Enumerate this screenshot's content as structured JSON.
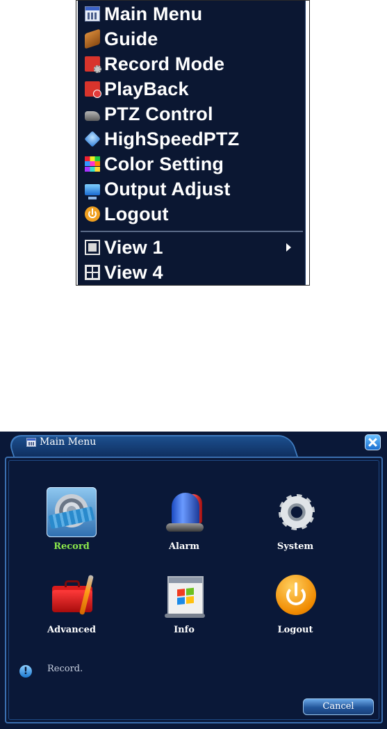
{
  "context_menu": {
    "items": [
      {
        "label": "Main Menu",
        "icon": "main-menu-icon"
      },
      {
        "label": "Guide",
        "icon": "guide-icon"
      },
      {
        "label": "Record Mode",
        "icon": "record-mode-icon"
      },
      {
        "label": "PlayBack",
        "icon": "playback-icon"
      },
      {
        "label": "PTZ Control",
        "icon": "ptz-camera-icon"
      },
      {
        "label": "HighSpeedPTZ",
        "icon": "high-speed-ptz-icon"
      },
      {
        "label": "Color Setting",
        "icon": "color-palette-icon"
      },
      {
        "label": "Output Adjust",
        "icon": "monitor-icon"
      },
      {
        "label": "Logout",
        "icon": "power-icon"
      }
    ],
    "view_items": [
      {
        "label": "View 1",
        "icon": "single-view-icon",
        "has_submenu": true
      },
      {
        "label": "View 4",
        "icon": "quad-view-icon",
        "has_submenu": false
      }
    ]
  },
  "dialog": {
    "title": "Main Menu",
    "items": [
      {
        "label": "Record",
        "icon": "record-film-reel-icon",
        "selected": true
      },
      {
        "label": "Alarm",
        "icon": "alarm-siren-icon",
        "selected": false
      },
      {
        "label": "System",
        "icon": "system-gear-icon",
        "selected": false
      },
      {
        "label": "Advanced",
        "icon": "toolbox-icon",
        "selected": false
      },
      {
        "label": "Info",
        "icon": "info-window-icon",
        "selected": false
      },
      {
        "label": "Logout",
        "icon": "power-icon",
        "selected": false
      }
    ],
    "status_text": "Record.",
    "cancel_label": "Cancel"
  },
  "colors": {
    "menu_background": "#0b1732",
    "dialog_background": "#0a1838",
    "selected_label": "#8be84b",
    "accent_blue": "#3b6fb0"
  }
}
